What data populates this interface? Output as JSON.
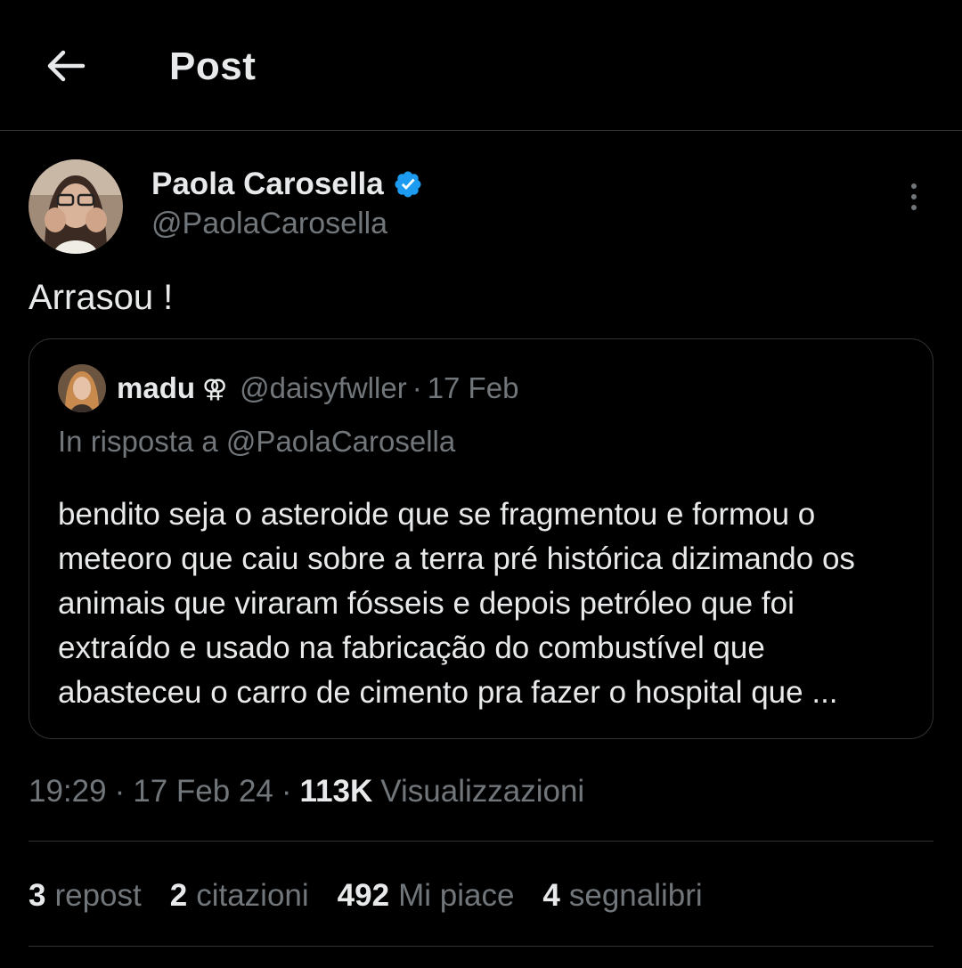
{
  "header": {
    "title": "Post"
  },
  "author": {
    "name": "Paola Carosella",
    "handle": "@PaolaCarosella",
    "verified": true,
    "verified_color": "#1d9bf0"
  },
  "post": {
    "text": "Arrasou !"
  },
  "quote": {
    "name": "madu",
    "symbol": "⚢",
    "handle": "@daisyfwller",
    "dot": "·",
    "date": "17 Feb",
    "reply_to": "In risposta a @PaolaCarosella",
    "body": "bendito seja o asteroide que se fragmentou e formou o meteoro que caiu sobre a terra pré histórica dizimando os animais que viraram fósseis e depois petróleo que foi extraído e usado na fabricação do combustível que abasteceu o carro de cimento pra fazer o hospital que ..."
  },
  "meta": {
    "time": "19:29",
    "date": "17 Feb 24",
    "sep": "·",
    "views_count": "113K",
    "views_label": "Visualizzazioni"
  },
  "stats": [
    {
      "num": "3",
      "label": "repost"
    },
    {
      "num": "2",
      "label": "citazioni"
    },
    {
      "num": "492",
      "label": "Mi piace"
    },
    {
      "num": "4",
      "label": "segnalibri"
    }
  ],
  "colors": {
    "background": "#000000",
    "text_primary": "#e7e9ea",
    "text_secondary": "#71767b",
    "border": "#2f3336"
  }
}
